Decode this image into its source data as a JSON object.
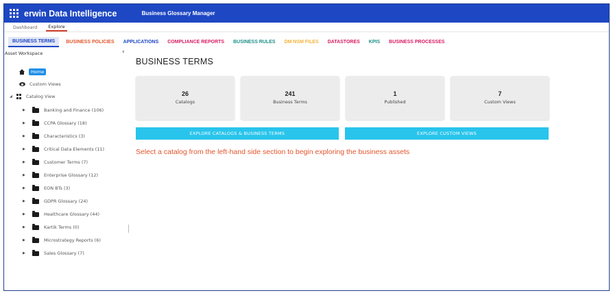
{
  "app": {
    "title": "erwin Data Intelligence",
    "module": "Business Glossary Manager"
  },
  "subnav": [
    {
      "label": "Dashboard",
      "active": false
    },
    {
      "label": "Explore",
      "active": true
    }
  ],
  "tabs": [
    {
      "label": "BUSINESS TERMS",
      "color": "#1e47c3",
      "active": true
    },
    {
      "label": "BUSINESS POLICIES",
      "color": "#e0562b",
      "active": false
    },
    {
      "label": "APPLICATIONS",
      "color": "#1e47c3",
      "active": false
    },
    {
      "label": "COMPLIANCE REPORTS",
      "color": "#d81b60",
      "active": false
    },
    {
      "label": "BUSINESS RULES",
      "color": "#1d8f86",
      "active": false
    },
    {
      "label": "DM NSM FILES",
      "color": "#f3b43c",
      "active": false
    },
    {
      "label": "DATASTORES",
      "color": "#d81b60",
      "active": false
    },
    {
      "label": "KPIS",
      "color": "#1d8f86",
      "active": false
    },
    {
      "label": "BUSINESS PROCESSES",
      "color": "#d81b60",
      "active": false
    }
  ],
  "sidebar": {
    "header": "Asset Workspace",
    "collapse_glyph": "‹",
    "home_label": "Home",
    "custom_views_label": "Custom Views",
    "catalog_view_label": "Catalog View",
    "catalogs": [
      "Banking and Finance (106)",
      "CCPA Glossary (18)",
      "Characteristics (3)",
      "Critical Data Elements (11)",
      "Customer Terms (7)",
      "Enterprise Glossary (12)",
      "EON BTs (3)",
      "GDPR Glossary (24)",
      "Healthcare Glossary (44)",
      "Kartik Terms (0)",
      "Microstrategy Reports (6)",
      "Sales Glossary (7)"
    ]
  },
  "main": {
    "title": "BUSINESS TERMS",
    "stats": [
      {
        "value": "26",
        "label": "Catalogs"
      },
      {
        "value": "241",
        "label": "Business Terms"
      },
      {
        "value": "1",
        "label": "Published"
      },
      {
        "value": "7",
        "label": "Custom Views"
      }
    ],
    "buttons": {
      "explore_catalogs": "EXPLORE CATALOGS & BUSINESS TERMS",
      "explore_custom_views": "EXPLORE CUSTOM VIEWS"
    },
    "hint": "Select a catalog from the left-hand side section to begin exploring the business assets"
  }
}
